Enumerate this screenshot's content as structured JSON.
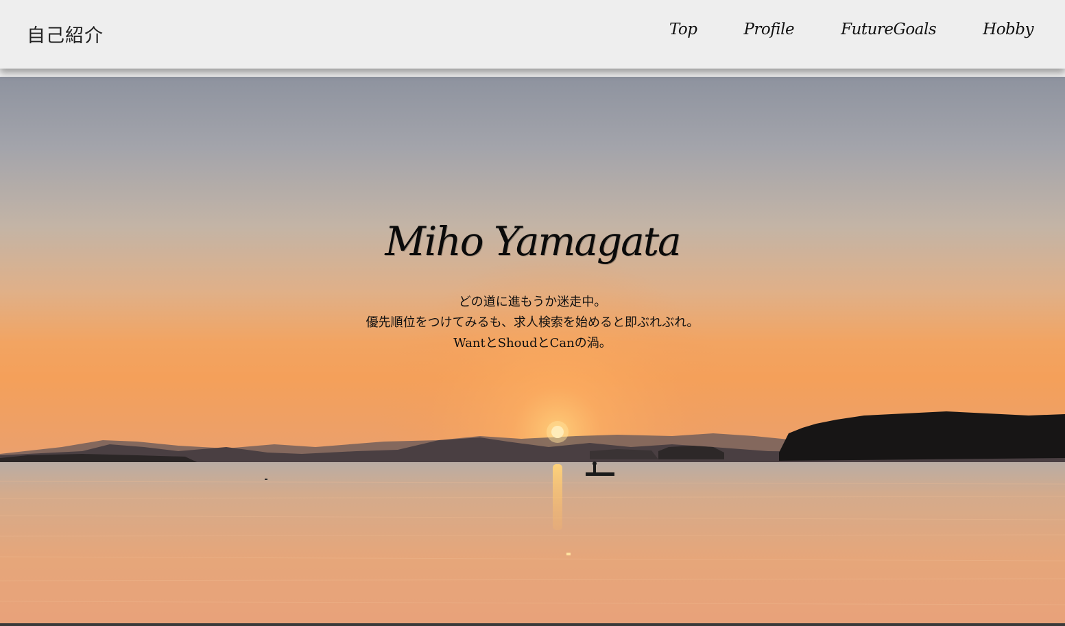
{
  "header": {
    "site_title": "自己紹介",
    "nav": [
      {
        "label": "Top"
      },
      {
        "label": "Profile"
      },
      {
        "label": "FutureGoals"
      },
      {
        "label": "Hobby"
      }
    ]
  },
  "hero": {
    "title": "Miho Yamagata",
    "lines": [
      "どの道に進もうか迷走中。",
      "優先順位をつけてみるも、求人検索を始めると即ぶれぶれ。",
      "WantとShoudとCanの渦。"
    ],
    "background_icon": "sunset-lake-photo"
  }
}
